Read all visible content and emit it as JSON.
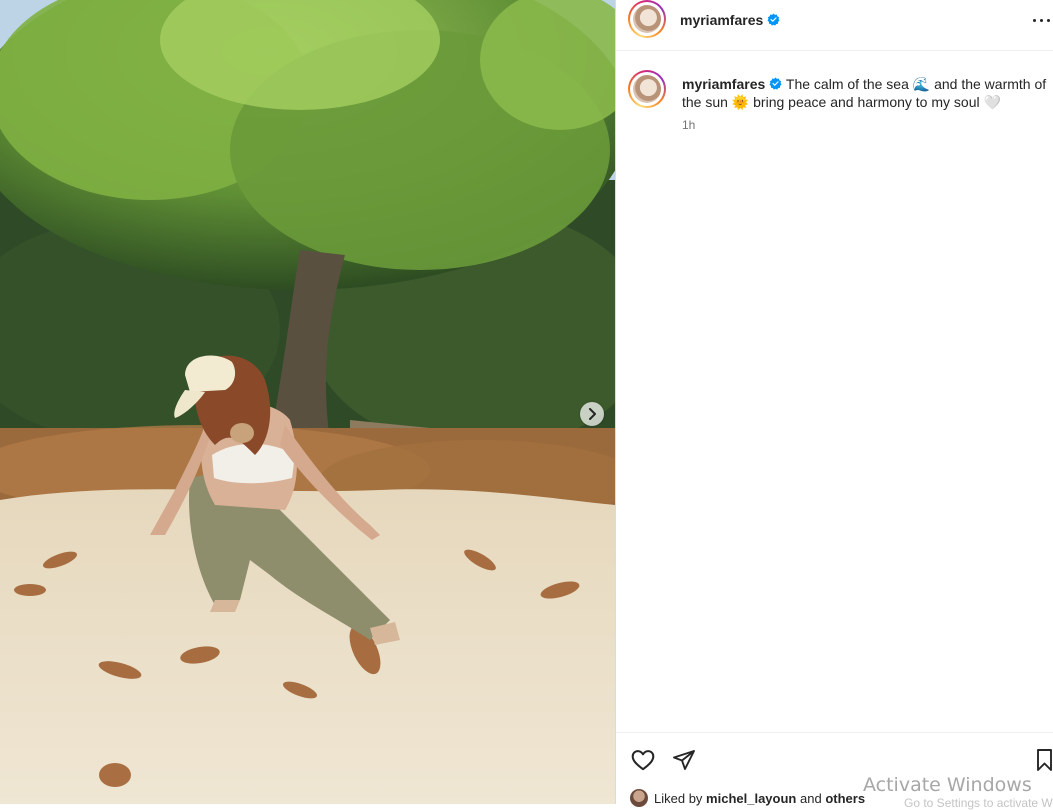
{
  "post": {
    "image_alt": "Woman in cap and white bikini top sitting on sand under a tree",
    "carousel_next": "next"
  },
  "header": {
    "username": "myriamfares",
    "more": "more options"
  },
  "caption": {
    "username": "myriamfares",
    "text": "The calm of the sea 🌊 and the warmth of the sun 🌞 bring peace and harmony to my soul 🤍",
    "time": "1h"
  },
  "likes": {
    "prefix": "Liked by",
    "user": "michel_layoun",
    "joiner": "and",
    "others": "others"
  },
  "watermark": {
    "title": "Activate Windows",
    "subtitle": "Go to Settings to activate Windows."
  },
  "colors": {
    "verified": "#0095f6",
    "text": "#262626",
    "muted": "#737373"
  }
}
